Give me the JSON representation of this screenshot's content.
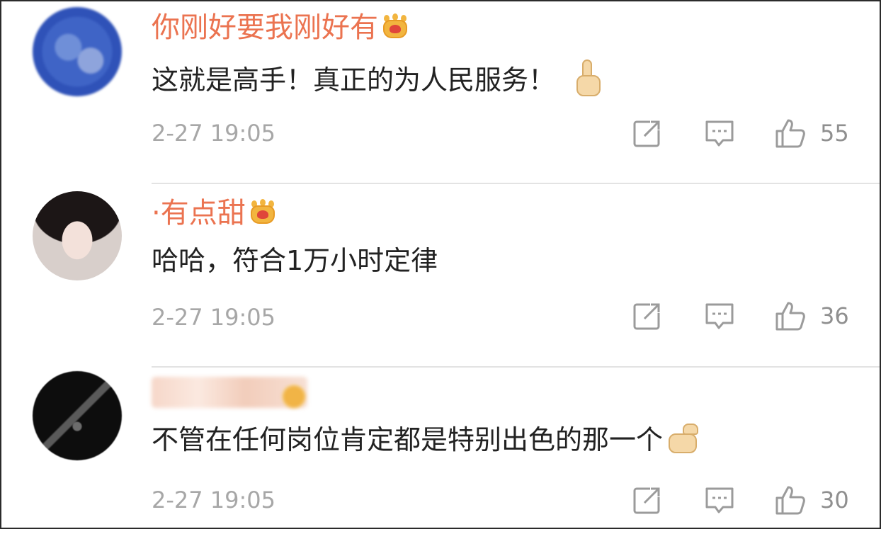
{
  "comments": [
    {
      "username": "你刚好要我刚好有",
      "text": "这就是高手！真正的为人民服务！",
      "time": "2-27 19:05",
      "likes": "55",
      "crown_icon": "crown-icon",
      "emoji_icon": "thumbs-up-emoji-icon"
    },
    {
      "username": "·有点甜",
      "text": "哈哈，符合1万小时定律",
      "time": "2-27 19:05",
      "likes": "36",
      "crown_icon": "crown-icon"
    },
    {
      "username": "",
      "text": "不管在任何岗位肯定都是特别出色的那一个",
      "time": "2-27 19:05",
      "likes": "30",
      "crown_icon": "crown-icon",
      "emoji_icon": "thumbs-up-emoji-icon"
    }
  ],
  "icons": {
    "forward": "share-forward-icon",
    "reply": "comment-reply-icon",
    "like": "thumbs-up-like-icon"
  },
  "colors": {
    "username": "#eb7350",
    "text": "#222222",
    "meta": "#a7a7a7",
    "icon": "#9b9b9b"
  }
}
